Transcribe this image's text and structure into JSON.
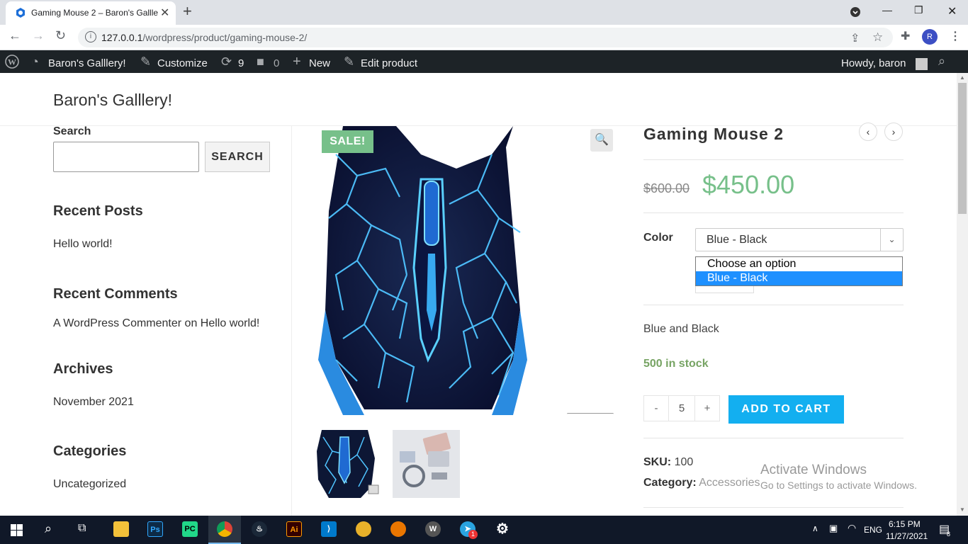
{
  "browser": {
    "tab_title": "Gaming Mouse 2 – Baron's Gallle",
    "url_host": "127.0.0.1",
    "url_path": "/wordpress/product/gaming-mouse-2/",
    "profile_initial": "R"
  },
  "adminbar": {
    "site_name": "Baron's Galllery!",
    "customize": "Customize",
    "updates_count": "9",
    "comments_count": "0",
    "new": "New",
    "edit_product": "Edit product",
    "howdy": "Howdy, baron"
  },
  "site": {
    "title": "Baron's Galllery!"
  },
  "sidebar": {
    "search_label": "Search",
    "search_button": "SEARCH",
    "recent_posts_title": "Recent Posts",
    "recent_post_1": "Hello world!",
    "recent_comments_title": "Recent Comments",
    "comment_author": "A WordPress Commenter",
    "comment_on": " on ",
    "comment_post": "Hello world!",
    "archives_title": "Archives",
    "archive_1": "November 2021",
    "categories_title": "Categories",
    "category_1": "Uncategorized"
  },
  "product": {
    "sale_badge": "SALE!",
    "title": "Gaming Mouse 2",
    "old_price": "$600.00",
    "new_price": "$450.00",
    "color_label": "Color",
    "color_selected": "Blue - Black",
    "color_options": [
      "Choose an option",
      "Blue - Black"
    ],
    "variation_description": "Blue and Black",
    "stock": "500 in stock",
    "qty_minus": "-",
    "quantity": "5",
    "qty_plus": "+",
    "add_to_cart": "ADD TO CART",
    "sku_label": "SKU:",
    "sku": "100",
    "category_label": "Category:",
    "category": "Accessories"
  },
  "watermark": {
    "line1": "Activate Windows",
    "line2": "Go to Settings to activate Windows."
  },
  "taskbar": {
    "lang": "ENG",
    "time": "6:15 PM",
    "date": "11/27/2021",
    "notif_count": "8",
    "telegram_badge": "1"
  },
  "colors": {
    "sale_green": "#77c08a",
    "accent_blue": "#13aff0",
    "admin_bar": "#1d2327"
  }
}
